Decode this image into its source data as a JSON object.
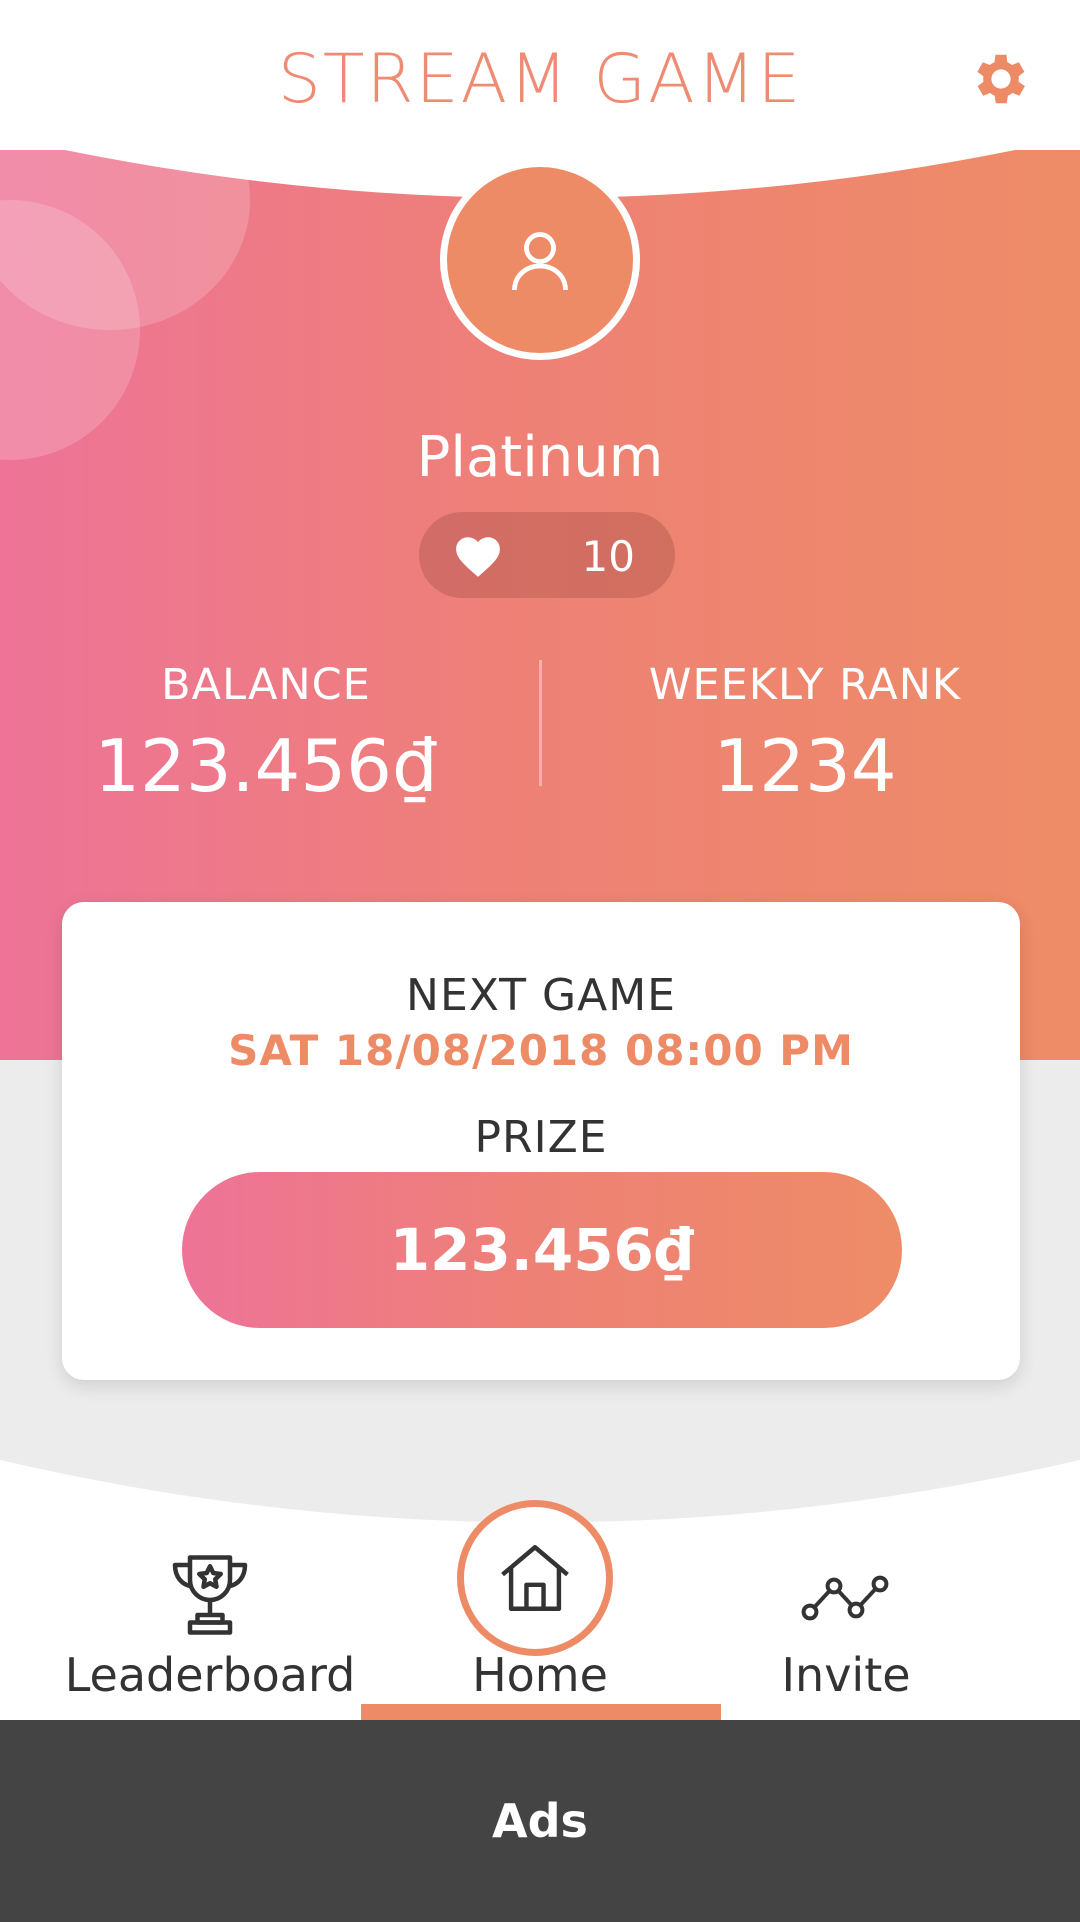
{
  "app": {
    "title": "STREAM GAME"
  },
  "profile": {
    "tier": "Platinum",
    "lives": "10"
  },
  "stats": {
    "balance_label": "BALANCE",
    "balance_value": "123.456₫",
    "rank_label": "WEEKLY RANK",
    "rank_value": "1234"
  },
  "next_game": {
    "label": "NEXT GAME",
    "datetime": "SAT 18/08/2018 08:00 PM",
    "prize_label": "PRIZE",
    "prize_value": "123.456₫"
  },
  "nav": {
    "items": [
      {
        "label": "Leaderboard",
        "icon": "trophy-icon"
      },
      {
        "label": "Home",
        "icon": "home-icon",
        "active": true
      },
      {
        "label": "Invite",
        "icon": "share-icon"
      }
    ]
  },
  "ads": {
    "label": "Ads"
  },
  "colors": {
    "accent": "#ee8b67",
    "gradient_start": "#ee7398",
    "gradient_end": "#ee8c67",
    "ads_bar": "#444444",
    "band": "#ececec"
  }
}
